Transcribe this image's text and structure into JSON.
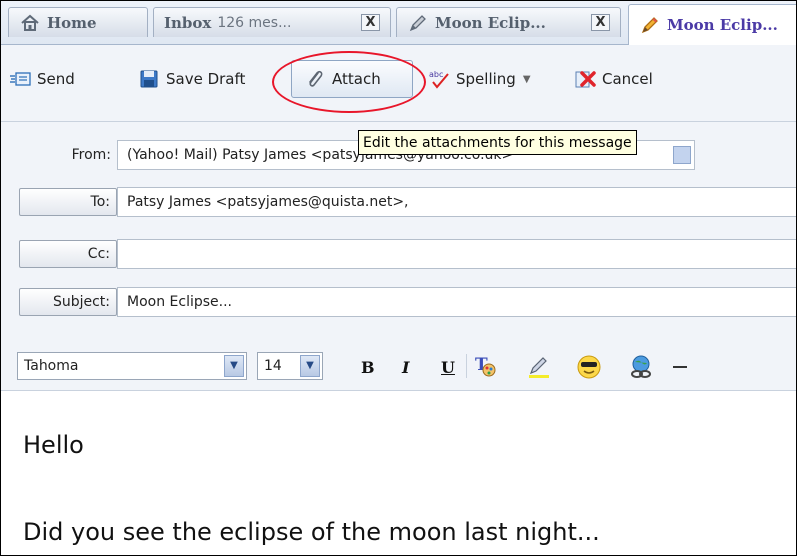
{
  "tabs": [
    {
      "label": "Home",
      "icon": "house-icon",
      "active": false
    },
    {
      "label": "Inbox",
      "sublabel": "126 mes...",
      "icon": "",
      "active": false,
      "closable": true
    },
    {
      "label": "Moon Eclip...",
      "icon": "pencil-icon",
      "active": false,
      "closable": true
    },
    {
      "label": "Moon Eclip...",
      "icon": "pencil-icon",
      "active": true
    }
  ],
  "close_glyph": "X",
  "toolbar": {
    "send": "Send",
    "save_draft": "Save Draft",
    "attach": "Attach",
    "spelling": "Spelling",
    "spelling_caret": "▼",
    "cancel": "Cancel"
  },
  "tooltip": "Edit the attachments for this message",
  "fields": {
    "from_label": "From:",
    "from_value": "(Yahoo! Mail) Patsy James <patsyjames@yahoo.co.uk>",
    "to_label": "To:",
    "to_value": "Patsy James <patsyjames@quista.net>,",
    "cc_label": "Cc:",
    "cc_value": "",
    "subject_label": "Subject:",
    "subject_value": "Moon Eclipse..."
  },
  "format": {
    "font": "Tahoma",
    "size": "14",
    "bold": "B",
    "italic": "I",
    "underline": "U",
    "dropdown_glyph": "▼"
  },
  "message": {
    "line1": "Hello",
    "line2": "Did you see the eclipse of the moon last night..."
  },
  "colors": {
    "annotation_circle": "#e8162a",
    "active_tab_text": "#4b3aa6",
    "tooltip_bg": "#ffffe1"
  }
}
